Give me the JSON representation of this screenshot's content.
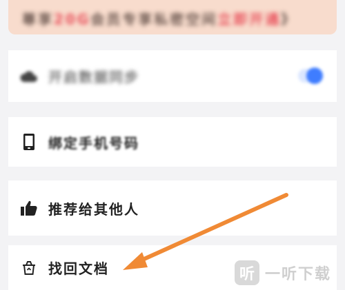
{
  "promo": {
    "text_a": "尊享",
    "text_b": "20G",
    "text_c": "会员专享私密空间",
    "text_d": "立即开通",
    "text_e": "》"
  },
  "menu": {
    "sync_label": "开启数据同步",
    "phone_label": "绑定手机号码",
    "share_label": "推荐给其他人",
    "recover_label": "找回文档"
  },
  "toggle": {
    "sync_enabled": true
  },
  "watermark": {
    "logo": "听",
    "text": "一听下载"
  },
  "colors": {
    "accent": "#3f7dff",
    "arrow": "#f08a35",
    "promo_bg": "#f8dccd"
  }
}
